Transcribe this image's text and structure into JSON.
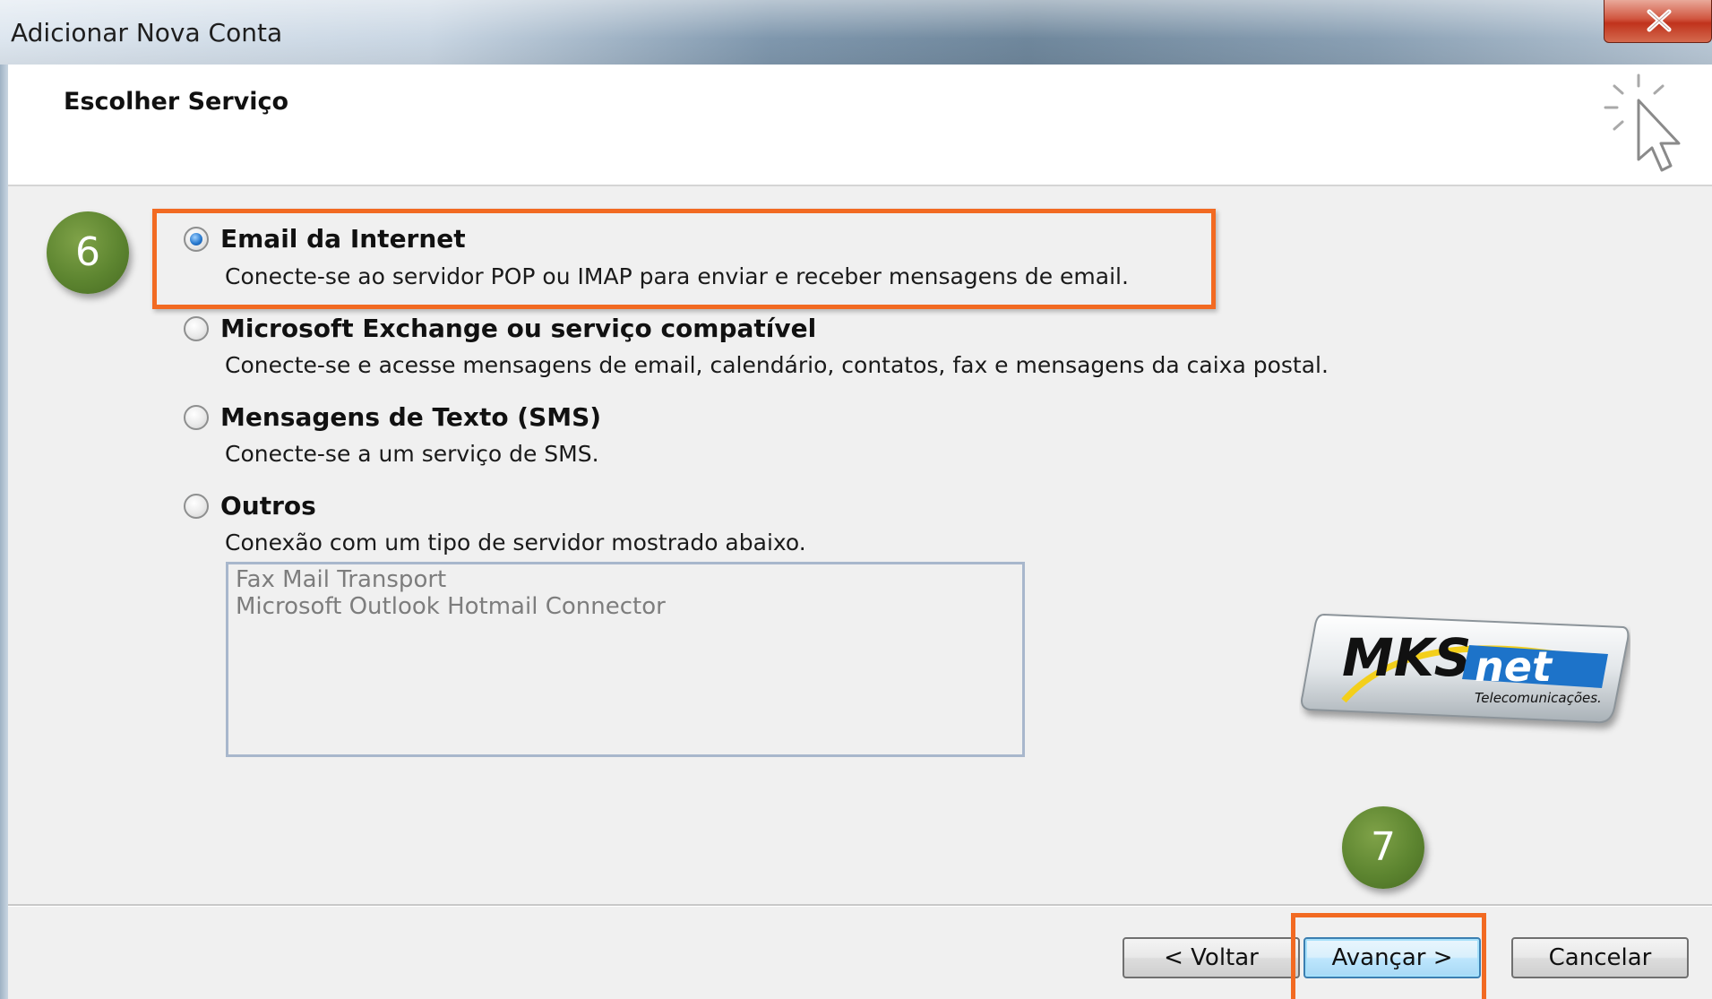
{
  "window": {
    "title": "Adicionar Nova Conta",
    "close_icon": "close-icon"
  },
  "header": {
    "title": "Escolher Serviço",
    "icon": "cursor-sparkle-icon"
  },
  "annotations": {
    "step6": "6",
    "step7": "7",
    "highlight_color": "#f26a22",
    "circle_color": "#5d8530"
  },
  "options": [
    {
      "label": "Email da Internet",
      "description": "Conecte-se ao servidor POP ou IMAP para enviar e receber mensagens de email.",
      "selected": true
    },
    {
      "label": "Microsoft Exchange ou serviço compatível",
      "description": "Conecte-se e acesse mensagens de email, calendário, contatos, fax e mensagens da caixa postal.",
      "selected": false
    },
    {
      "label": "Mensagens de Texto (SMS)",
      "description": "Conecte-se a um serviço de SMS.",
      "selected": false
    },
    {
      "label": "Outros",
      "description": "Conexão com um tipo de servidor mostrado abaixo.",
      "selected": false
    }
  ],
  "other_servers": [
    "Fax Mail Transport",
    "Microsoft Outlook Hotmail Connector"
  ],
  "logo": {
    "brand_left": "MKS",
    "brand_right": "net",
    "tagline": "Telecomunicações."
  },
  "buttons": {
    "back": "< Voltar",
    "next": "Avançar >",
    "cancel": "Cancelar"
  }
}
